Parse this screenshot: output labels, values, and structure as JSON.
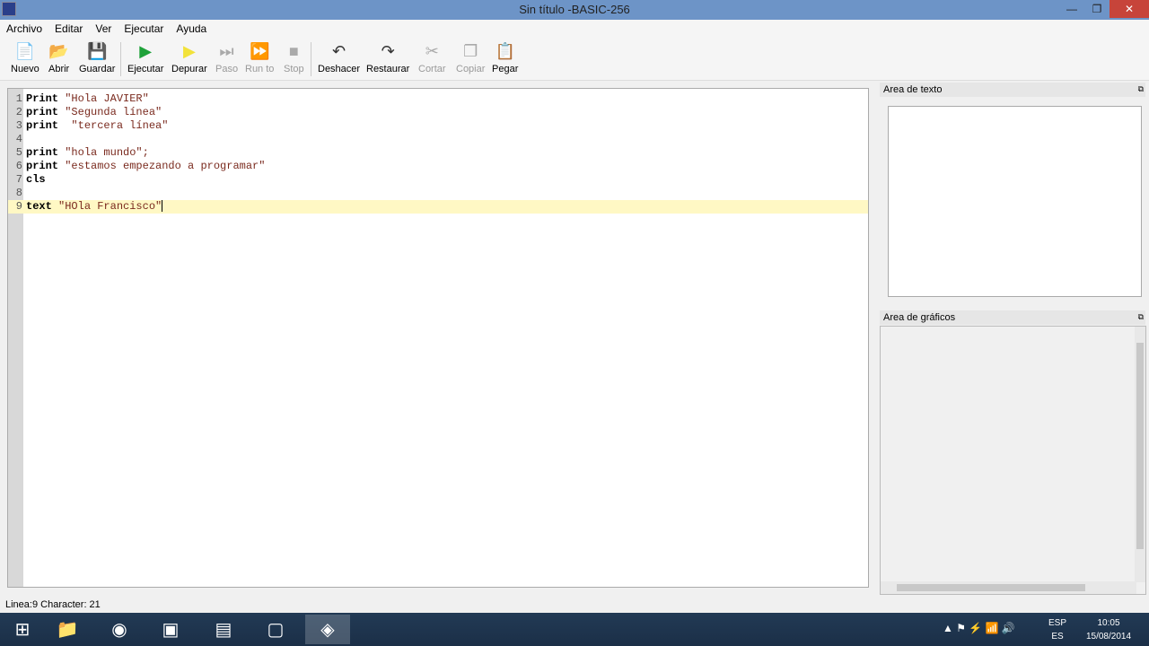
{
  "window": {
    "title": "Sin título -BASIC-256",
    "minimize": "—",
    "restore": "❐",
    "close": "✕"
  },
  "menu": [
    "Archivo",
    "Editar",
    "Ver",
    "Ejecutar",
    "Ayuda"
  ],
  "toolbar": [
    {
      "label": "Nuevo",
      "icon": "new-file-icon",
      "glyph": "📄",
      "enabled": true
    },
    {
      "label": "Abrir",
      "icon": "open-icon",
      "glyph": "📂",
      "enabled": true
    },
    {
      "label": "Guardar",
      "icon": "save-icon",
      "glyph": "💾",
      "enabled": true
    },
    {
      "label": "Ejecutar",
      "icon": "run-icon",
      "glyph": "▶",
      "enabled": true
    },
    {
      "label": "Depurar",
      "icon": "debug-icon",
      "glyph": "▶",
      "enabled": true
    },
    {
      "label": "Paso",
      "icon": "step-icon",
      "glyph": "⏭",
      "enabled": false
    },
    {
      "label": "Run to",
      "icon": "run-to-icon",
      "glyph": "⏩",
      "enabled": false
    },
    {
      "label": "Stop",
      "icon": "stop-icon",
      "glyph": "■",
      "enabled": false
    },
    {
      "label": "Deshacer",
      "icon": "undo-icon",
      "glyph": "↶",
      "enabled": true
    },
    {
      "label": "Restaurar",
      "icon": "redo-icon",
      "glyph": "↷",
      "enabled": true
    },
    {
      "label": "Cortar",
      "icon": "cut-icon",
      "glyph": "✂",
      "enabled": false
    },
    {
      "label": "Copiar",
      "icon": "copy-icon",
      "glyph": "❐",
      "enabled": false
    },
    {
      "label": "Pegar",
      "icon": "paste-icon",
      "glyph": "📋",
      "enabled": true
    }
  ],
  "editor": {
    "lines": [
      {
        "n": "1",
        "kw": "Print",
        "rest": " \"Hola JAVIER\""
      },
      {
        "n": "2",
        "kw": "print",
        "rest": " \"Segunda línea\""
      },
      {
        "n": "3",
        "kw": "print",
        "rest": "  \"tercera línea\""
      },
      {
        "n": "4",
        "kw": "",
        "rest": ""
      },
      {
        "n": "5",
        "kw": "print",
        "rest": " \"hola mundo\";"
      },
      {
        "n": "6",
        "kw": "print",
        "rest": " \"estamos empezando a programar\""
      },
      {
        "n": "7",
        "kw": "cls",
        "rest": ""
      },
      {
        "n": "8",
        "kw": "",
        "rest": ""
      },
      {
        "n": "9",
        "kw": "text",
        "rest": " \"HOla Francisco\""
      }
    ],
    "current_line": 9
  },
  "panels": {
    "text_area": "Area de texto",
    "graphics_area": "Area de gráficos",
    "float": "⧉"
  },
  "status": "Linea:9 Character: 21",
  "taskbar": {
    "apps": [
      {
        "name": "start",
        "glyph": "⊞"
      },
      {
        "name": "explorer",
        "glyph": "📁"
      },
      {
        "name": "chrome",
        "glyph": "◉"
      },
      {
        "name": "app3",
        "glyph": "▣"
      },
      {
        "name": "app4",
        "glyph": "▤"
      },
      {
        "name": "app5",
        "glyph": "▢"
      },
      {
        "name": "basic256",
        "glyph": "◈"
      }
    ],
    "lang1": "ESP",
    "lang2": "ES",
    "time": "10:05",
    "date": "15/08/2014",
    "tray_icons": "▲  ⚑  ⚡  📶  🔊"
  }
}
